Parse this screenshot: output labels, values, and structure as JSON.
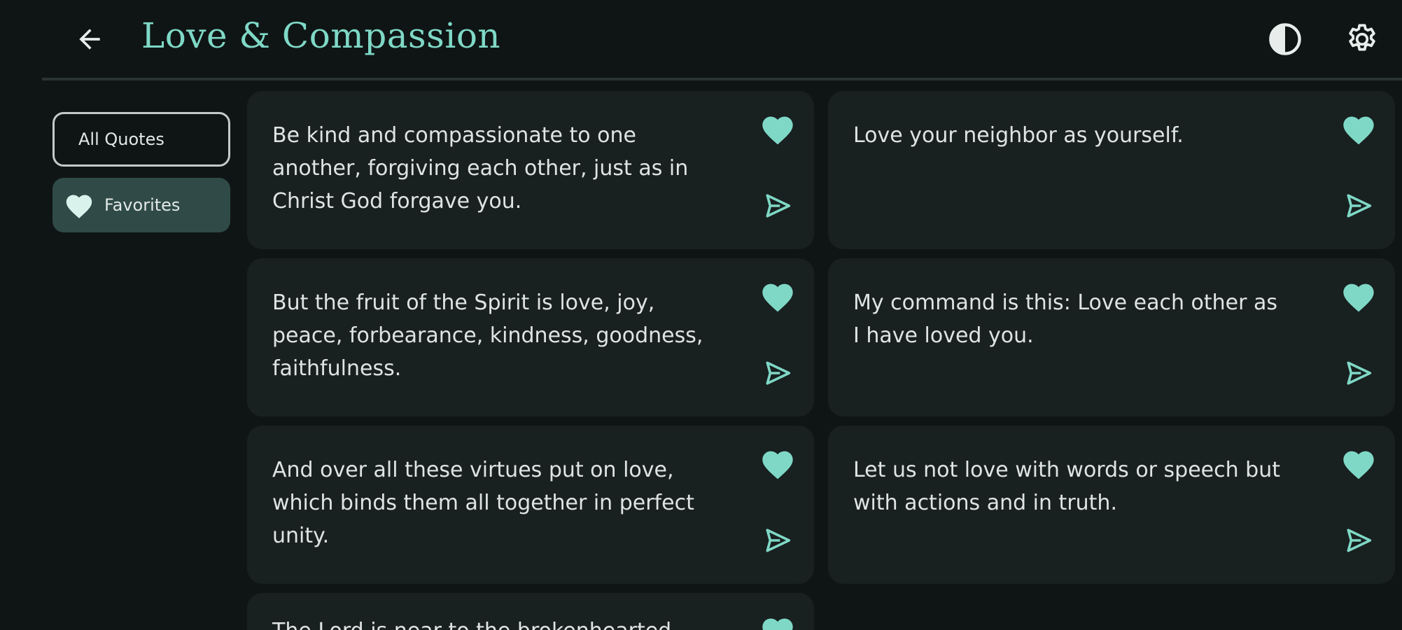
{
  "header": {
    "title": "Love & Compassion",
    "back_icon": "arrow-back-icon",
    "contrast_icon": "contrast-icon",
    "settings_icon": "gear-icon"
  },
  "sidebar": {
    "items": [
      {
        "label": "All Quotes",
        "selected": false
      },
      {
        "label": "Favorites",
        "selected": true,
        "icon": "heart-icon"
      }
    ]
  },
  "quotes": [
    {
      "text": "Be kind and compassionate to one another, forgiving each other, just as in Christ God forgave you.",
      "favorite": true
    },
    {
      "text": "Love your neighbor as yourself.",
      "favorite": true
    },
    {
      "text": "But the fruit of the Spirit is love, joy, peace, forbearance, kindness, goodness, faithfulness.",
      "favorite": true
    },
    {
      "text": "My command is this: Love each other as I have loved you.",
      "favorite": true
    },
    {
      "text": "And over all these virtues put on love, which binds them all together in perfect unity.",
      "favorite": true
    },
    {
      "text": "Let us not love with words or speech but with actions and in truth.",
      "favorite": true
    },
    {
      "text": "The Lord is near to the brokenhearted",
      "favorite": true
    }
  ],
  "colors": {
    "accent": "#7fd8c6",
    "background": "#0f1515",
    "card": "#182020",
    "text": "#dfe4e3",
    "selected_nav": "#2f4a47"
  }
}
